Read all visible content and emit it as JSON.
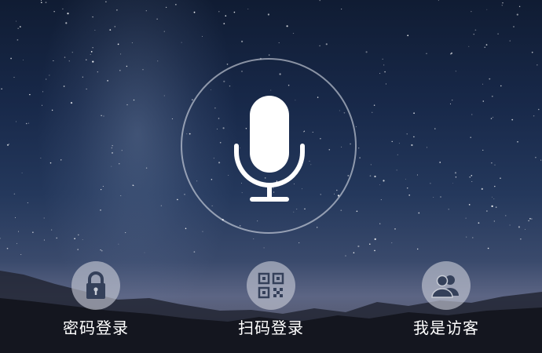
{
  "voice": {
    "icon": "microphone-icon"
  },
  "options": [
    {
      "label": "密码登录",
      "icon": "lock-icon"
    },
    {
      "label": "扫码登录",
      "icon": "qr-code-icon"
    },
    {
      "label": "我是访客",
      "icon": "users-icon"
    }
  ],
  "colors": {
    "icon_circle": "#c8ccd6",
    "icon_glyph": "#34405a",
    "label": "#ffffff"
  }
}
